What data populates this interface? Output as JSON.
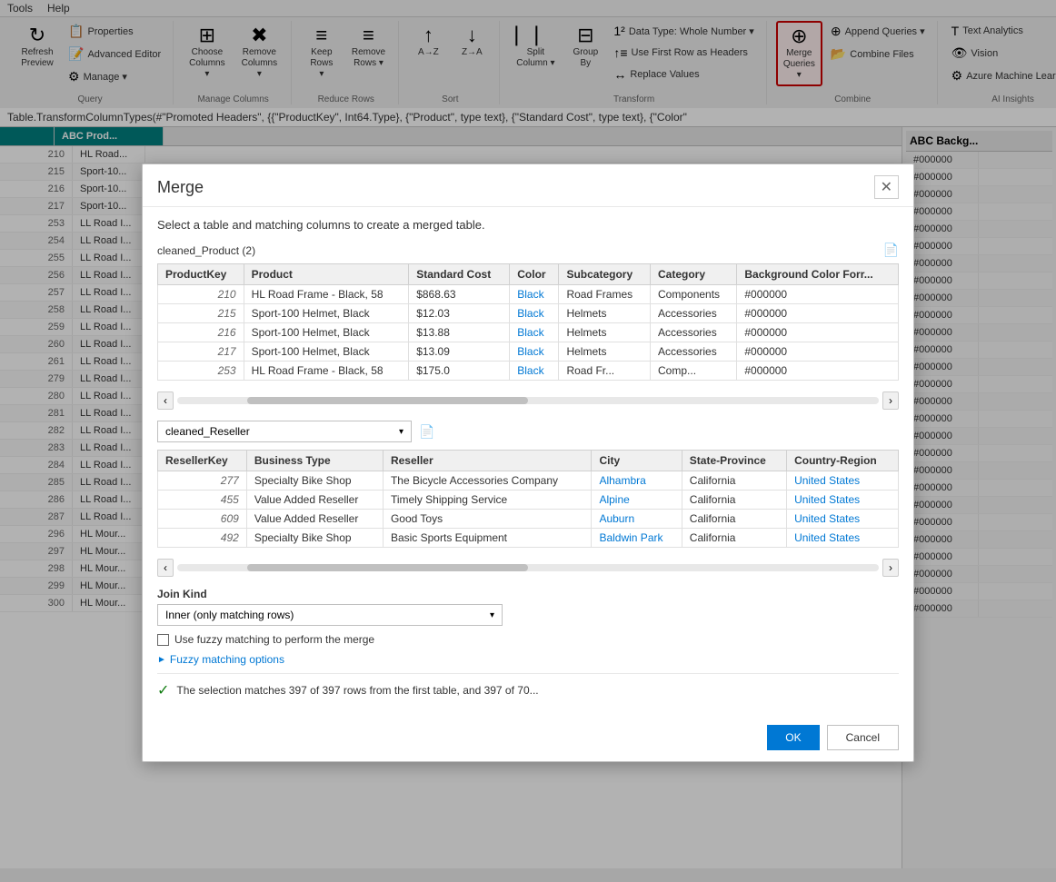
{
  "menu": {
    "tools": "Tools",
    "help": "Help"
  },
  "ribbon": {
    "groups": [
      {
        "label": "Query",
        "items": [
          {
            "id": "refresh-preview",
            "label": "Refresh\nPreview",
            "icon": "↻"
          },
          {
            "id": "properties",
            "label": "Properties",
            "icon": "📋"
          },
          {
            "id": "advanced-editor",
            "label": "Advanced Editor",
            "icon": "📝"
          },
          {
            "id": "manage",
            "label": "Manage",
            "icon": "⚙"
          }
        ]
      },
      {
        "label": "Manage Columns",
        "items": [
          {
            "id": "choose-columns",
            "label": "Choose\nColumns",
            "icon": "⊞"
          },
          {
            "id": "remove-columns",
            "label": "Remove\nColumns",
            "icon": "✖⊞"
          }
        ]
      },
      {
        "label": "Reduce Rows",
        "items": [
          {
            "id": "keep-rows",
            "label": "Keep\nRows",
            "icon": "≡+"
          },
          {
            "id": "remove-rows",
            "label": "Remove\nRows",
            "icon": "≡-"
          }
        ]
      },
      {
        "label": "Sort",
        "items": [
          {
            "id": "sort-az",
            "label": "A→Z",
            "icon": "↑"
          },
          {
            "id": "sort-za",
            "label": "Z→A",
            "icon": "↓"
          }
        ]
      },
      {
        "label": "Transform",
        "items": [
          {
            "id": "data-type",
            "label": "Data Type: Whole Number",
            "icon": "1²"
          },
          {
            "id": "use-first-row",
            "label": "Use First Row as Headers",
            "icon": "↑≡"
          },
          {
            "id": "replace-values",
            "label": "Replace Values",
            "icon": "ab→cd"
          },
          {
            "id": "split-column",
            "label": "Split\nColumn",
            "icon": "⎸⎸"
          },
          {
            "id": "group-by",
            "label": "Group\nBy",
            "icon": "⊟"
          }
        ]
      },
      {
        "label": "Combine",
        "items": [
          {
            "id": "merge-queries",
            "label": "Merge Queries",
            "icon": "⊕",
            "highlighted": true
          },
          {
            "id": "append-queries",
            "label": "Append Queries",
            "icon": "⊕+"
          },
          {
            "id": "combine-files",
            "label": "Combine Files",
            "icon": "📂"
          }
        ]
      },
      {
        "label": "AI Insights",
        "items": [
          {
            "id": "text-analytics",
            "label": "Text Analytics",
            "icon": "T"
          },
          {
            "id": "vision",
            "label": "Vision",
            "icon": "👁"
          },
          {
            "id": "azure-ml",
            "label": "Azure Machine Learning",
            "icon": "⚙"
          }
        ]
      }
    ]
  },
  "formula_bar": "Table.TransformColumnTypes(#\"Promoted Headers\", {{\"ProductKey\", Int64.Type}, {\"Product\", type text}, {\"Standard Cost\", type text}, {\"Color\"",
  "data_table": {
    "columns": [
      "",
      "ABC Prod..."
    ],
    "rows": [
      {
        "num": "210",
        "prod": "HL Road..."
      },
      {
        "num": "215",
        "prod": "Sport-10..."
      },
      {
        "num": "216",
        "prod": "Sport-10..."
      },
      {
        "num": "217",
        "prod": "Sport-10..."
      },
      {
        "num": "253",
        "prod": "LL Road I..."
      },
      {
        "num": "254",
        "prod": "LL Road I..."
      },
      {
        "num": "255",
        "prod": "LL Road I..."
      },
      {
        "num": "256",
        "prod": "LL Road I..."
      },
      {
        "num": "257",
        "prod": "LL Road I..."
      },
      {
        "num": "258",
        "prod": "LL Road I..."
      },
      {
        "num": "259",
        "prod": "LL Road I..."
      },
      {
        "num": "260",
        "prod": "LL Road I..."
      },
      {
        "num": "261",
        "prod": "LL Road I..."
      },
      {
        "num": "279",
        "prod": "LL Road I..."
      },
      {
        "num": "280",
        "prod": "LL Road I..."
      },
      {
        "num": "281",
        "prod": "LL Road I..."
      },
      {
        "num": "282",
        "prod": "LL Road I..."
      },
      {
        "num": "283",
        "prod": "LL Road I..."
      },
      {
        "num": "284",
        "prod": "LL Road I..."
      },
      {
        "num": "285",
        "prod": "LL Road I..."
      },
      {
        "num": "286",
        "prod": "LL Road I..."
      },
      {
        "num": "287",
        "prod": "LL Road I..."
      },
      {
        "num": "296",
        "prod": "HL Mour..."
      },
      {
        "num": "297",
        "prod": "HL Mour..."
      },
      {
        "num": "298",
        "prod": "HL Mour..."
      },
      {
        "num": "299",
        "prod": "HL Mour..."
      },
      {
        "num": "300",
        "prod": "HL Mour..."
      }
    ],
    "right_col_header": "ABC Backg...",
    "right_col_values": [
      "#000000",
      "#000000",
      "#000000",
      "#000000",
      "#000000",
      "#000000",
      "#000000",
      "#000000",
      "#000000",
      "#000000",
      "#000000",
      "#000000",
      "#000000",
      "#000000",
      "#000000",
      "#000000",
      "#000000",
      "#000000",
      "#000000",
      "#000000",
      "#000000",
      "#000000",
      "#000000",
      "#000000",
      "#000000",
      "#000000",
      "#000000"
    ]
  },
  "modal": {
    "title": "Merge",
    "close_label": "✕",
    "description": "Select a table and matching columns to create a merged table.",
    "top_table": {
      "label": "cleaned_Product (2)",
      "columns": [
        "ProductKey",
        "Product",
        "Standard Cost",
        "Color",
        "Subcategory",
        "Category",
        "Background Color Forr..."
      ],
      "rows": [
        {
          "key": "210",
          "product": "HL Road Frame - Black, 58",
          "cost": "$868.63",
          "color": "Black",
          "subcat": "Road Frames",
          "cat": "Components",
          "bg": "#000000"
        },
        {
          "key": "215",
          "product": "Sport-100 Helmet, Black",
          "cost": "$12.03",
          "color": "Black",
          "subcat": "Helmets",
          "cat": "Accessories",
          "bg": "#000000"
        },
        {
          "key": "216",
          "product": "Sport-100 Helmet, Black",
          "cost": "$13.88",
          "color": "Black",
          "subcat": "Helmets",
          "cat": "Accessories",
          "bg": "#000000"
        },
        {
          "key": "217",
          "product": "Sport-100 Helmet, Black",
          "cost": "$13.09",
          "color": "Black",
          "subcat": "Helmets",
          "cat": "Accessories",
          "bg": "#000000"
        },
        {
          "key": "253",
          "product": "HL Road Frame - Black, 58",
          "cost": "$175.0",
          "color": "Black",
          "subcat": "Road Fr...",
          "cat": "Comp...",
          "bg": "#000000"
        }
      ]
    },
    "bottom_table_dropdown": "cleaned_Reseller",
    "bottom_table": {
      "columns": [
        "ResellerKey",
        "Business Type",
        "Reseller",
        "City",
        "State-Province",
        "Country-Region"
      ],
      "rows": [
        {
          "key": "277",
          "btype": "Specialty Bike Shop",
          "reseller": "The Bicycle Accessories Company",
          "city": "Alhambra",
          "state": "California",
          "country": "United States"
        },
        {
          "key": "455",
          "btype": "Value Added Reseller",
          "reseller": "Timely Shipping Service",
          "city": "Alpine",
          "state": "California",
          "country": "United States"
        },
        {
          "key": "609",
          "btype": "Value Added Reseller",
          "reseller": "Good Toys",
          "city": "Auburn",
          "state": "California",
          "country": "United States"
        },
        {
          "key": "492",
          "btype": "Specialty Bike Shop",
          "reseller": "Basic Sports Equipment",
          "city": "Baldwin Park",
          "state": "California",
          "country": "United States"
        }
      ]
    },
    "join_kind_label": "Join Kind",
    "join_kind_value": "Inner (only matching rows)",
    "fuzzy_label": "Use fuzzy matching to perform the merge",
    "fuzzy_options_label": "Fuzzy matching options",
    "status_text": "The selection matches 397 of 397 rows from the first table, and 397 of 70...",
    "ok_label": "OK",
    "cancel_label": "Cancel"
  }
}
